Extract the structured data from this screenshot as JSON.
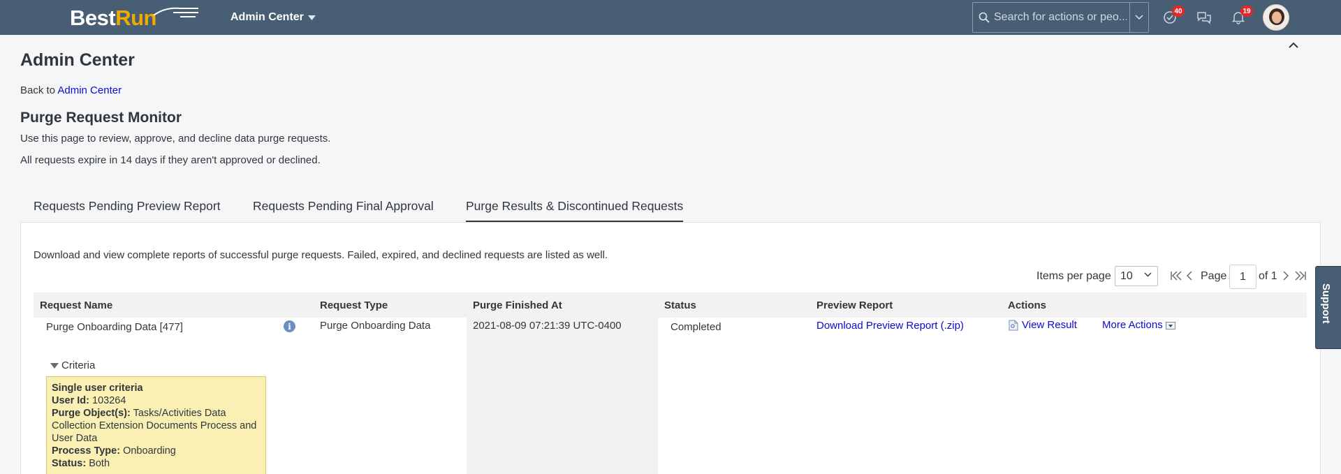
{
  "shell": {
    "logo_best": "Best",
    "logo_run": "Run",
    "app_menu": "Admin Center",
    "search_placeholder": "Search for actions or peo...",
    "todo_count": "40",
    "notification_count": "19"
  },
  "page": {
    "title": "Admin Center",
    "back_prefix": "Back to ",
    "back_link": "Admin Center",
    "monitor_title": "Purge Request Monitor",
    "description_1": "Use this page to review, approve, and decline data purge requests.",
    "description_2": "All requests expire in 14 days if they aren't approved or declined."
  },
  "tabs": [
    {
      "label": "Requests Pending Preview Report"
    },
    {
      "label": "Requests Pending Final Approval"
    },
    {
      "label": "Purge Results & Discontinued Requests"
    }
  ],
  "panel": {
    "description": "Download and view complete reports of successful purge requests. Failed, expired, and declined requests are listed as well.",
    "items_per_page_label": "Items per page",
    "items_per_page": "10",
    "page_label": "Page",
    "page_value": "1",
    "page_of": "of 1"
  },
  "table": {
    "headers": [
      "Request Name",
      "Request Type",
      "Purge Finished At",
      "Status",
      "Preview Report",
      "Actions"
    ],
    "row": {
      "name": "Purge Onboarding Data [477]",
      "type": "Purge Onboarding Data",
      "finished_at": "2021-08-09 07:21:39 UTC-0400",
      "status": "Completed",
      "preview_link": "Download Preview Report (.zip)",
      "view_result": "View Result",
      "more_actions": "More Actions",
      "criteria_label": "Criteria",
      "criteria": {
        "heading": "Single user criteria",
        "user_id_label": "User Id:",
        "user_id": "103264",
        "objects_label": "Purge Object(s):",
        "objects": "Tasks/Activities Data Collection Extension Documents Process and User Data",
        "process_label": "Process Type:",
        "process": "Onboarding",
        "status_label": "Status:",
        "status": "Both"
      }
    }
  },
  "support_label": "Support",
  "colors": {
    "shell": "#475e75",
    "brand_orange": "#f0ab00",
    "link": "#0a0ad2",
    "criteria_bg": "#faf0b4",
    "badge": "#e02a2a"
  }
}
